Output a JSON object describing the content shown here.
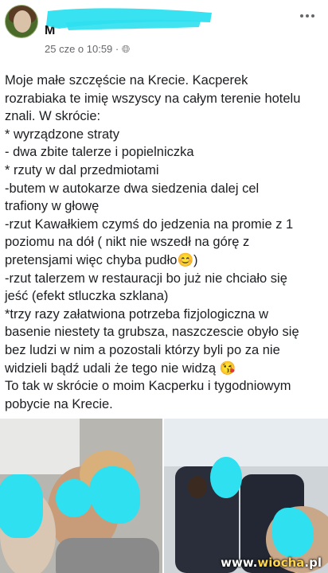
{
  "post": {
    "author_initial": "M",
    "timestamp": "25 cze o 10:59 · ",
    "privacy_icon": "globe-icon",
    "more_icon": "more-horizontal-icon",
    "lines": [
      "Moje małe szczęście na Krecie. Kacperek",
      "rozrabiaka te imię wszyscy na całym terenie hotelu",
      "znali. W skrócie:",
      "* wyrządzone straty",
      "- dwa zbite talerze i popielniczka",
      "* rzuty w dal przedmiotami",
      "-butem w autokarze dwa siedzenia dalej cel",
      "trafiony w głowę",
      "-rzut Kawałkiem czymś do jedzenia na promie z 1",
      "poziomu na dół ( nikt nie wszedł na górę z",
      "pretensjami więc chyba pudło😊)",
      "-rzut talerzem w restauracji bo już nie chciało się",
      "jeść (efekt stluczka szklana)",
      "*trzy razy załatwiona potrzeba fizjologiczna w",
      "basenie niestety ta grubsza, naszczescie  obyło się",
      "bez ludzi w nim a pozostali którzy byli po za nie",
      "widzieli bądź udali że tego nie widzą 😘",
      "To tak w skrócie o moim Kacperku i tygodniowym",
      "pobycie na Krecie."
    ]
  },
  "photos": {
    "left": "photo-family-selfie",
    "right": "photo-ferry-seats"
  },
  "watermark": {
    "prefix": "www.",
    "accent": "wiocha",
    "suffix": ".pl"
  },
  "colors": {
    "redaction": "#2ee0f0",
    "text": "#1c1e21",
    "meta": "#65676b"
  }
}
